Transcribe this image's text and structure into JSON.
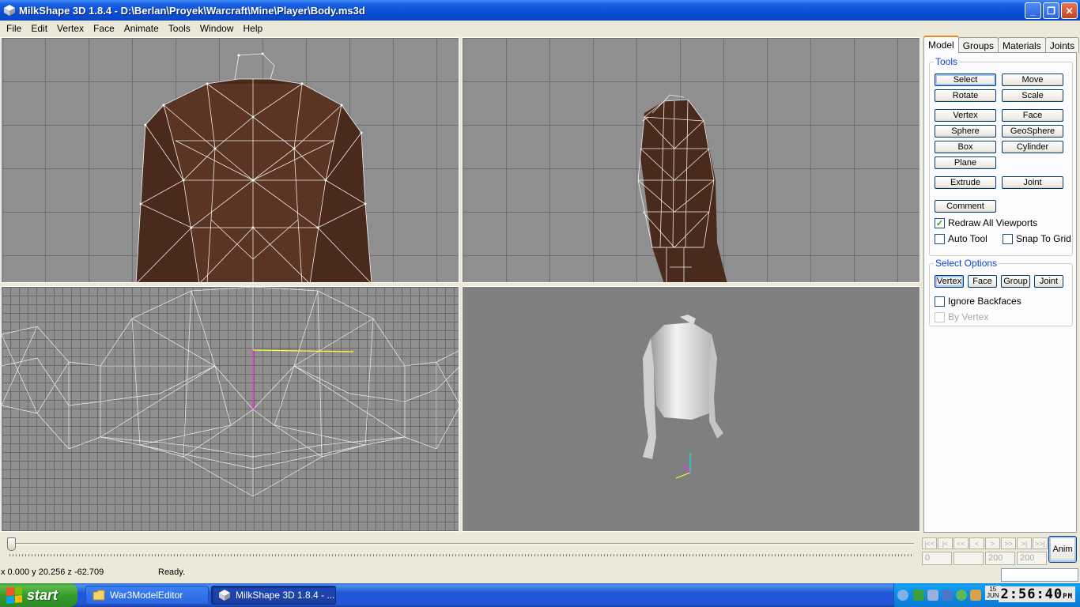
{
  "window": {
    "title": "MilkShape 3D 1.8.4 - D:\\Berlan\\Proyek\\Warcraft\\Mine\\Player\\Body.ms3d",
    "minimize": "_",
    "restore": "❐",
    "close": "✕"
  },
  "menu": [
    "File",
    "Edit",
    "Vertex",
    "Face",
    "Animate",
    "Tools",
    "Window",
    "Help"
  ],
  "panel": {
    "tabs": [
      "Model",
      "Groups",
      "Materials",
      "Joints"
    ],
    "active_tab": "Model",
    "tools_label": "Tools",
    "tools": {
      "select": "Select",
      "move": "Move",
      "rotate": "Rotate",
      "scale": "Scale",
      "vertex": "Vertex",
      "face": "Face",
      "sphere": "Sphere",
      "geosphere": "GeoSphere",
      "box": "Box",
      "cylinder": "Cylinder",
      "plane": "Plane",
      "extrude": "Extrude",
      "joint": "Joint",
      "comment": "Comment"
    },
    "redraw_all": {
      "label": "Redraw All Viewports",
      "checked": true
    },
    "auto_tool": {
      "label": "Auto Tool",
      "checked": false
    },
    "snap_grid": {
      "label": "Snap To Grid",
      "checked": false
    },
    "select_options_label": "Select Options",
    "select_options": {
      "vertex": "Vertex",
      "face": "Face",
      "group": "Group",
      "joint": "Joint"
    },
    "ignore_backfaces": {
      "label": "Ignore Backfaces",
      "checked": false
    },
    "by_vertex": {
      "label": "By Vertex",
      "checked": false
    }
  },
  "timeline": {
    "nav": [
      "|<<",
      "|<",
      "<<",
      "<",
      ">",
      ">>",
      ">|",
      ">>|"
    ],
    "frame_current": "0",
    "frame_blank": "",
    "frame_a": "200",
    "frame_b": "200",
    "anim_label": "Anim"
  },
  "status": {
    "coords": "x 0.000 y 20.256 z -62.709",
    "text": "Ready."
  },
  "taskbar": {
    "start": "start",
    "tasks": [
      "War3ModelEditor",
      "MilkShape 3D 1.8.4 - ..."
    ],
    "date_day": "15",
    "date_month": "JUN",
    "clock": "2:56:40",
    "clock_suffix": "PM"
  }
}
